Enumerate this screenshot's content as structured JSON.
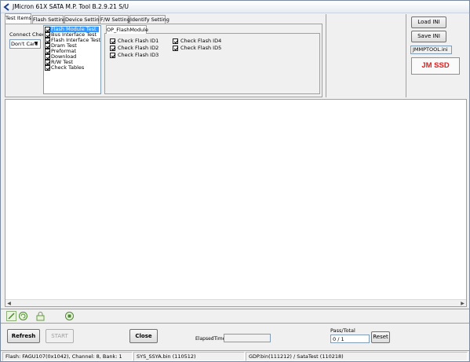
{
  "window": {
    "title": "JMicron 61X SATA M.P. Tool B.2.9.21 S/U"
  },
  "tabs": [
    {
      "label": "Test Items"
    },
    {
      "label": "Flash Setting"
    },
    {
      "label": "Device Setting"
    },
    {
      "label": "F/W Setting"
    },
    {
      "label": "Identify Setting"
    }
  ],
  "connect_check": {
    "label": "Connect Check",
    "selected": "Don't Care"
  },
  "test_items": [
    {
      "label": "Flash Module Test",
      "checked": true,
      "selected": true
    },
    {
      "label": "Bus Interface Test",
      "checked": true
    },
    {
      "label": "Flash Interface Test",
      "checked": true
    },
    {
      "label": "Dram Test",
      "checked": true
    },
    {
      "label": "Preformat",
      "checked": true
    },
    {
      "label": "Download",
      "checked": true
    },
    {
      "label": "R/W Test",
      "checked": true
    },
    {
      "label": "Check Tables",
      "checked": true
    }
  ],
  "sub_tab": {
    "label": "OP_FlashModule"
  },
  "flash_checks_col1": [
    {
      "label": "Check Flash ID1",
      "checked": true
    },
    {
      "label": "Check Flash ID2",
      "checked": true
    },
    {
      "label": "Check Flash ID3",
      "checked": true
    }
  ],
  "flash_checks_col2": [
    {
      "label": "Check Flash ID4",
      "checked": true
    },
    {
      "label": "Check Flash ID5",
      "checked": true
    }
  ],
  "right_panel": {
    "load_ini": "Load INI",
    "save_ini": "Save INI",
    "ini_file": "JMMPTOOL.ini",
    "logo": "JM SSD",
    "logo_color": "#e02020"
  },
  "bottom": {
    "refresh": "Refresh",
    "start": "START",
    "close": "Close",
    "elapsed_label": "ElapsedTime",
    "elapsed_value": "",
    "pass_total_label": "Pass/Total",
    "pass_total_value": "0 / 1",
    "reset": "Reset"
  },
  "status": {
    "flash": "Flash: FAGU107(0x1042), Channel: 8, Bank: 1",
    "sys": "SYS_SSYA.bin (110512)",
    "gdp": "GDP.bin(111212) / SataTest (110218)"
  }
}
